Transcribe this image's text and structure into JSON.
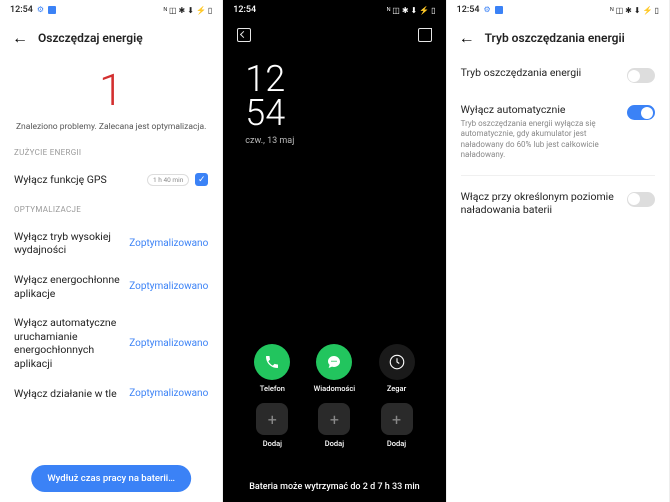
{
  "status": {
    "time": "12:54",
    "signal": "ᴺ ◫ ✱ ⬇ ⚡ ▯"
  },
  "pane1": {
    "title": "Oszczędzaj energię",
    "bignum": "1",
    "subtitle": "Znaleziono problemy. Zalecana jest optymalizacja.",
    "sec_energy": "ZUŻYCIE ENERGII",
    "gps_label": "Wyłącz funkcję GPS",
    "gps_chip": "1 h 40 min",
    "sec_opt": "OPTYMALIZACJE",
    "opt_status": "Zoptymalizowano",
    "rows": {
      "r1": "Wyłącz tryb wysokiej wydajności",
      "r2": "Wyłącz energochłonne aplikacje",
      "r3": "Wyłącz automatyczne uruchamianie energochłonnych aplikacji",
      "r4": "Wyłącz działanie w tle"
    },
    "button": "Wydłuż czas pracy na baterii…"
  },
  "pane2": {
    "hh": "12",
    "mm": "54",
    "date": "czw., 13 maj",
    "apps": {
      "phone": "Telefon",
      "msg": "Wiadomości",
      "clock": "Zegar",
      "add": "Dodaj"
    },
    "bottom": "Bateria może wytrzymać do 2 d 7 h 33 min"
  },
  "pane3": {
    "title": "Tryb oszczędzania energii",
    "s1_title": "Tryb oszczędzania energii",
    "s2_title": "Wyłącz automatycznie",
    "s2_desc": "Tryb oszczędzania energii wyłącza się automatycznie, gdy akumulator jest naładowany do 60% lub jest całkowicie naładowany.",
    "s3_title": "Włącz przy określonym poziomie naładowania baterii"
  }
}
